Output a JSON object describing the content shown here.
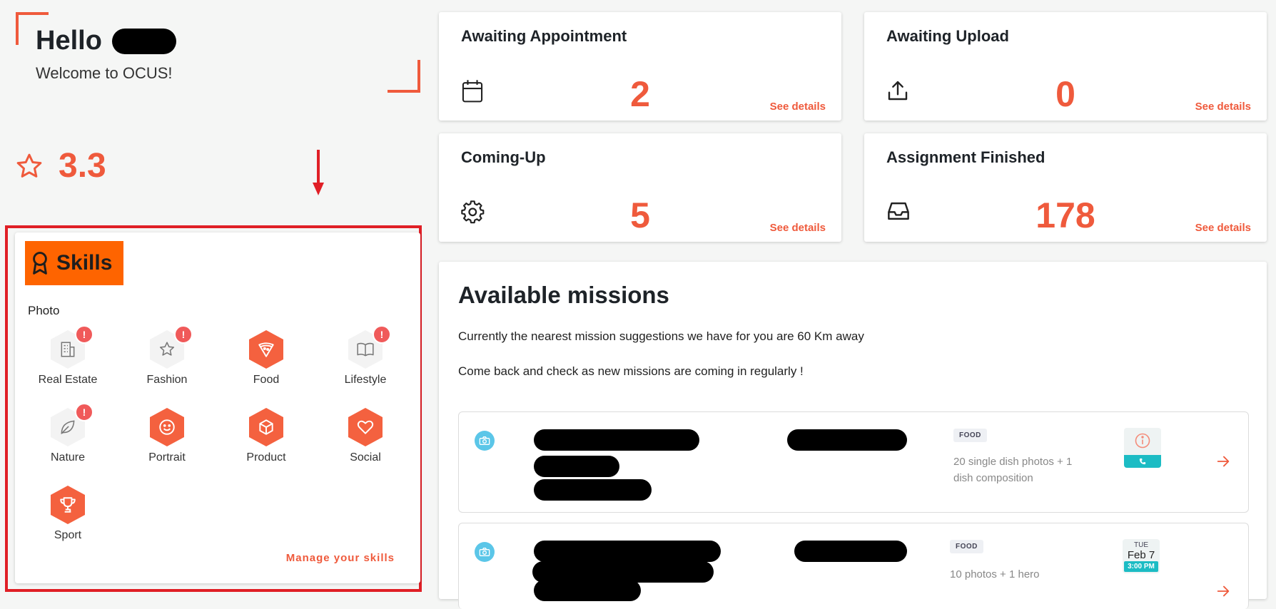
{
  "header": {
    "greeting": "Hello",
    "welcome": "Welcome to OCUS!"
  },
  "rating": {
    "value": "3.3",
    "icon": "star-outline-icon"
  },
  "colors": {
    "accent": "#ef5a3c",
    "highlight": "#fe6400",
    "annotation": "#e01f26",
    "teal": "#1cbcc4"
  },
  "skills": {
    "title": "Skills",
    "category": "Photo",
    "items": [
      {
        "label": "Real Estate",
        "icon": "building-icon",
        "active": false,
        "alert": true
      },
      {
        "label": "Fashion",
        "icon": "star-icon",
        "active": false,
        "alert": true
      },
      {
        "label": "Food",
        "icon": "pizza-icon",
        "active": true,
        "alert": false
      },
      {
        "label": "Lifestyle",
        "icon": "book-icon",
        "active": false,
        "alert": true
      },
      {
        "label": "Nature",
        "icon": "leaf-icon",
        "active": false,
        "alert": true
      },
      {
        "label": "Portrait",
        "icon": "smile-icon",
        "active": true,
        "alert": false
      },
      {
        "label": "Product",
        "icon": "box-icon",
        "active": true,
        "alert": false
      },
      {
        "label": "Social",
        "icon": "heart-icon",
        "active": true,
        "alert": false
      },
      {
        "label": "Sport",
        "icon": "trophy-icon",
        "active": true,
        "alert": false
      }
    ],
    "alert_mark": "!",
    "manage_label": "Manage your skills"
  },
  "stats": [
    {
      "title": "Awaiting Appointment",
      "value": "2",
      "icon": "calendar-icon",
      "link": "See details"
    },
    {
      "title": "Awaiting Upload",
      "value": "0",
      "icon": "upload-icon",
      "link": "See details"
    },
    {
      "title": "Coming-Up",
      "value": "5",
      "icon": "gear-icon",
      "link": "See details"
    },
    {
      "title": "Assignment Finished",
      "value": "178",
      "icon": "inbox-icon",
      "link": "See details"
    }
  ],
  "missions": {
    "title": "Available missions",
    "line1": "Currently the nearest mission suggestions we have for you are 60 Km away",
    "line2": "Come back and check as new missions are coming in regularly !",
    "rows": [
      {
        "tag": "FOOD",
        "description": "20 single dish photos + 1 dish composition",
        "icon": "info-icon"
      },
      {
        "tag": "FOOD",
        "description": "10 photos + 1 hero",
        "day": "TUE",
        "date": "Feb 7",
        "time": "3:00 PM"
      }
    ]
  }
}
